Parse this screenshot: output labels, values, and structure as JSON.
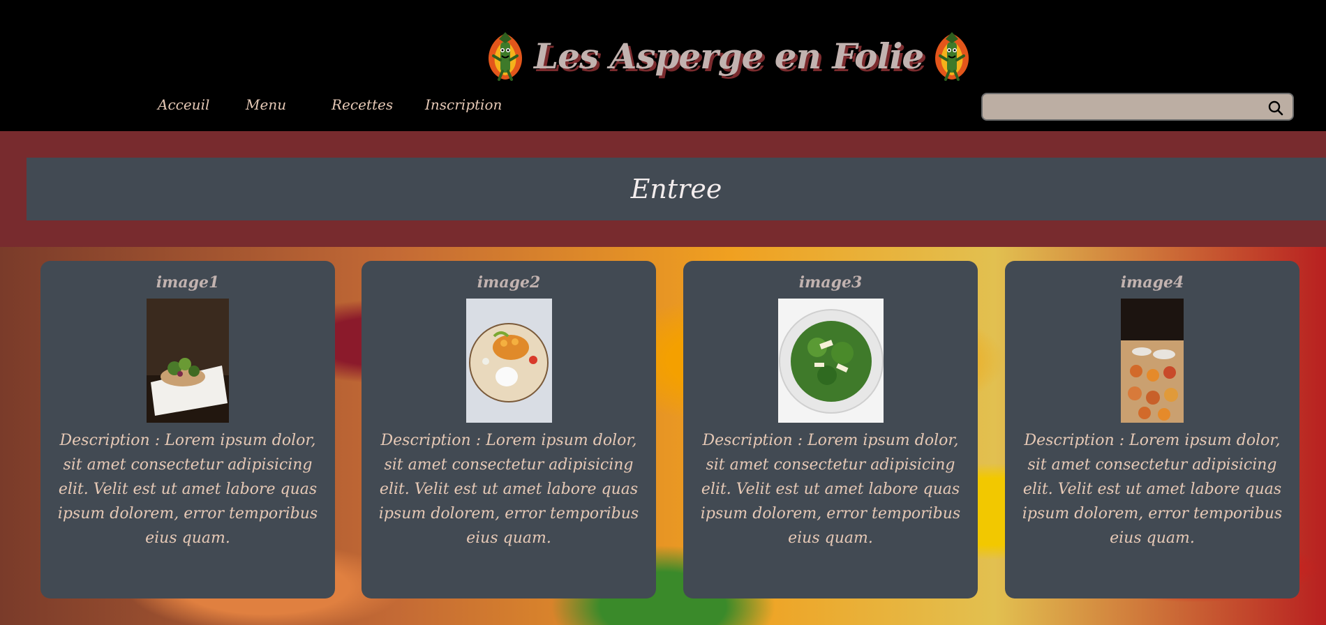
{
  "header": {
    "brand": "Les Asperge en Folie",
    "nav": [
      "Acceuil",
      "Menu",
      "Recettes",
      "Inscription"
    ],
    "search": {
      "placeholder": ""
    }
  },
  "section": {
    "title": "Entree"
  },
  "cards": [
    {
      "title": "image1",
      "description": "Description : Lorem ipsum dolor, sit amet consectetur adipisicing elit. Velit est ut amet labore quas ipsum dolorem, error temporibus eius quam."
    },
    {
      "title": "image2",
      "description": "Description : Lorem ipsum dolor, sit amet consectetur adipisicing elit. Velit est ut amet labore quas ipsum dolorem, error temporibus eius quam."
    },
    {
      "title": "image3",
      "description": "Description : Lorem ipsum dolor, sit amet consectetur adipisicing elit. Velit est ut amet labore quas ipsum dolorem, error temporibus eius quam."
    },
    {
      "title": "image4",
      "description": "Description : Lorem ipsum dolor, sit amet consectetur adipisicing elit. Velit est ut amet labore quas ipsum dolorem, error temporibus eius quam."
    }
  ],
  "colors": {
    "header_bg": "#000000",
    "band": "#782b2e",
    "panel": "#424a53",
    "accent_text": "#e6c9b6",
    "title_text": "#c2b3b0"
  }
}
